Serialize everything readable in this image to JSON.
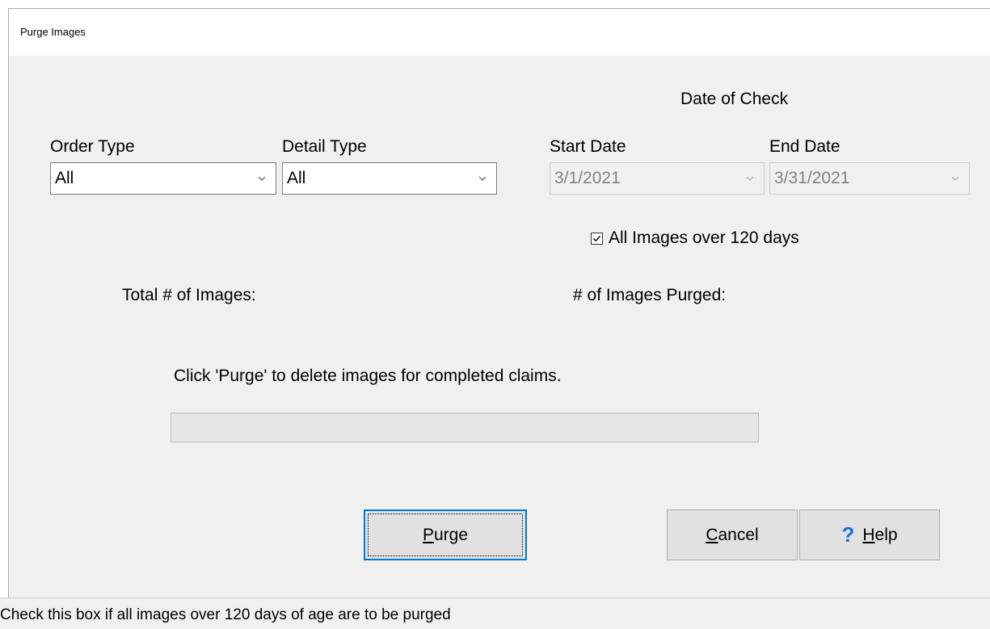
{
  "window": {
    "title": "Purge Images"
  },
  "date_group": {
    "heading": "Date of Check",
    "start_label": "Start Date",
    "start_value": "3/1/2021",
    "end_label": "End Date",
    "end_value": "3/31/2021"
  },
  "filters": {
    "order_type_label": "Order Type",
    "order_type_value": "All",
    "detail_type_label": "Detail Type",
    "detail_type_value": "All"
  },
  "all_images_checkbox": {
    "label": "All Images over 120 days",
    "checked": true
  },
  "counts": {
    "total_label": "Total # of Images:",
    "purged_label": "# of Images Purged:"
  },
  "instructions": "Click 'Purge' to delete images for completed claims.",
  "progress": {
    "fraction": 0
  },
  "buttons": {
    "purge_mnemonic": "P",
    "purge_rest": "urge",
    "cancel_mnemonic": "C",
    "cancel_rest": "ancel",
    "help_icon": "?",
    "help_mnemonic": "H",
    "help_rest": "elp"
  },
  "status_bar": {
    "text": "Check this box if all images over 120 days of age are to be purged"
  },
  "icons": {
    "dropdown": "chevron-down-icon",
    "help": "question-mark-icon",
    "check": "checkmark-icon"
  },
  "colors": {
    "accent": "#0078d7",
    "help_icon": "#1f6fd6",
    "dialog_bg": "#f0f0f0",
    "disabled_text": "#838383"
  }
}
